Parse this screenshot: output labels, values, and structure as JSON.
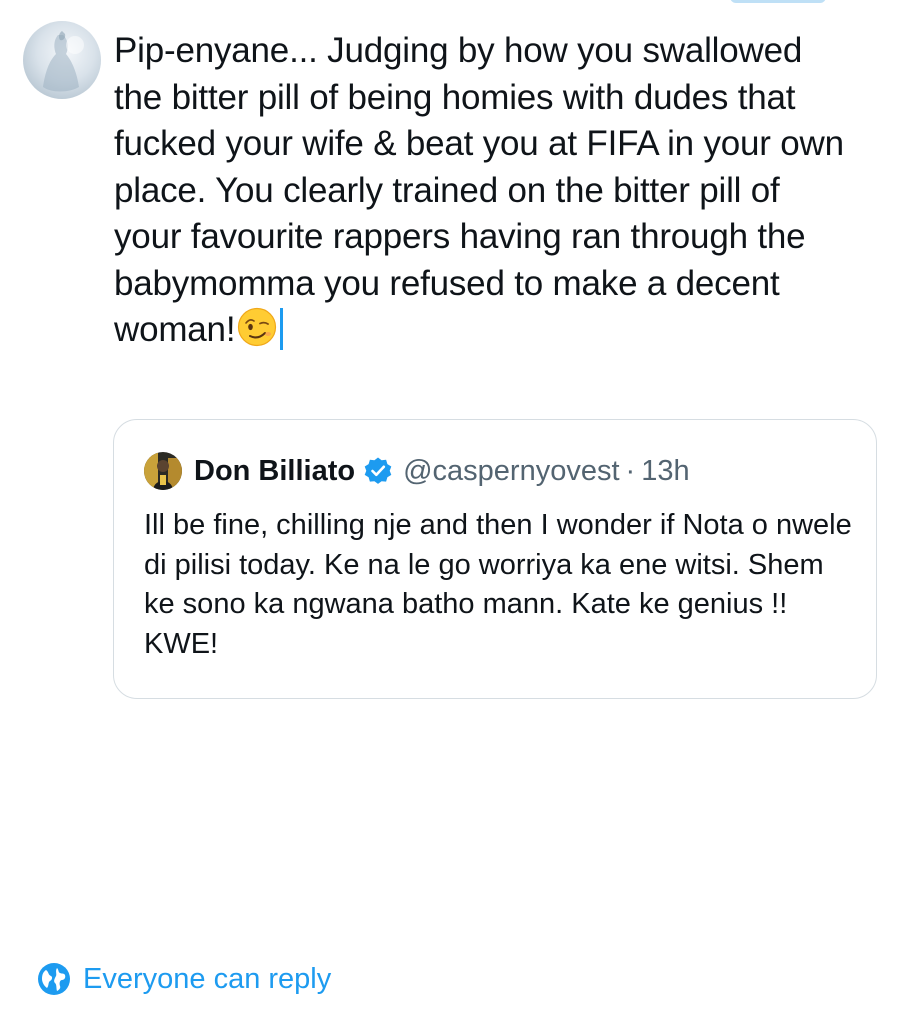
{
  "compose": {
    "text": "Pip-enyane... Judging by how you swallowed the bitter pill of being homies with dudes that fucked your wife & beat you at FIFA in your own place. You clearly trained on the bitter pill of your favourite rappers having ran through the babymomma you refused to make a decent woman!",
    "emoji": "winking-face-emoji"
  },
  "quoted_tweet": {
    "display_name": "Don Billiato",
    "handle": "@caspernyovest",
    "separator": "·",
    "time": "13h",
    "text": "Ill be fine, chilling nje and then I wonder if Nota o nwele di pilisi today. Ke na le go worriya ka ene witsi. Shem ke sono ka ngwana batho mann. Kate ke genius !! KWE!",
    "verified": true
  },
  "reply_setting": {
    "label": "Everyone can reply",
    "icon": "globe-icon"
  },
  "colors": {
    "accent": "#1d9bf0",
    "text_primary": "#0f1419",
    "text_secondary": "#536471",
    "border": "#d6dde2"
  }
}
